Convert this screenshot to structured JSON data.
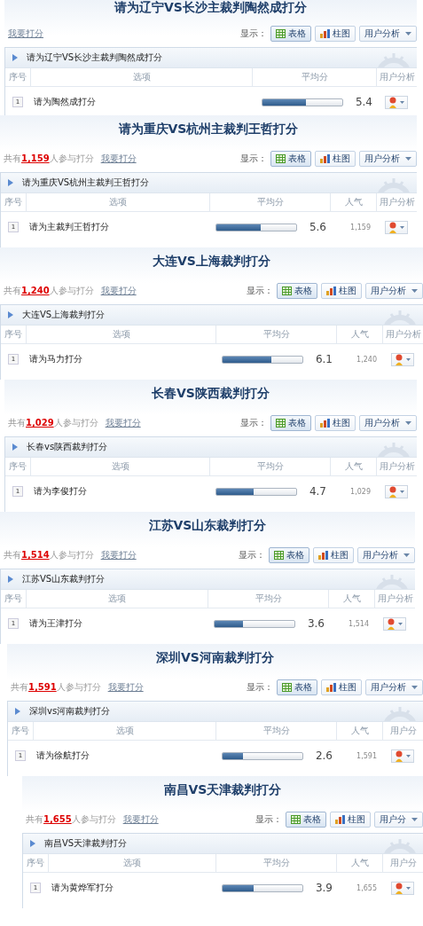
{
  "polls": [
    {
      "title": "请为辽宁VS长沙主裁判陶然成打分",
      "vote_link": "我要打分",
      "display_label": "显示：",
      "view_buttons": [
        {
          "label": "表格",
          "kind": "table",
          "selected": true
        },
        {
          "label": "柱图",
          "kind": "bar",
          "selected": false
        }
      ],
      "analysis_button": "用户分析",
      "subtitle": "请为辽宁VS长沙主裁判陶然成打分",
      "columns": [
        "序号",
        "选项",
        "平均分",
        "用户分析"
      ],
      "rows": [
        {
          "index": "1",
          "option": "请为陶然成打分",
          "level": 0.54,
          "score": "5.4"
        }
      ]
    },
    {
      "title": "请为重庆VS杭州主裁判王哲打分",
      "count": "共有**1,159**人参与打分",
      "vote_link": "我要打分",
      "display_label": "显示：",
      "view_buttons": [
        {
          "label": "表格",
          "kind": "table",
          "selected": true
        },
        {
          "label": "柱图",
          "kind": "bar",
          "selected": false
        }
      ],
      "analysis_button": "用户分析",
      "subtitle": "请为重庆VS杭州主裁判王哲打分",
      "columns": [
        "序号",
        "选项",
        "平均分",
        "人气",
        "用户分析"
      ],
      "rows": [
        {
          "index": "1",
          "option": "请为主裁判王哲打分",
          "level": 0.56,
          "score": "5.6",
          "popularity": "1,159"
        }
      ]
    },
    {
      "title": "大连VS上海裁判打分",
      "count": "共有**1,240**人参与打分",
      "vote_link": "我要打分",
      "display_label": "显示：",
      "view_buttons": [
        {
          "label": "表格",
          "kind": "table",
          "selected": true
        },
        {
          "label": "柱图",
          "kind": "bar",
          "selected": false
        }
      ],
      "analysis_button": "用户分析",
      "subtitle": "大连VS上海裁判打分",
      "columns": [
        "序号",
        "选项",
        "平均分",
        "人气",
        "用户分析"
      ],
      "rows": [
        {
          "index": "1",
          "option": "请为马力打分",
          "level": 0.61,
          "score": "6.1",
          "popularity": "1,240"
        }
      ]
    },
    {
      "title": "长春VS陕西裁判打分",
      "count": "共有**1,029**人参与打分",
      "vote_link": "我要打分",
      "display_label": "显示：",
      "view_buttons": [
        {
          "label": "表格",
          "kind": "table",
          "selected": true
        },
        {
          "label": "柱图",
          "kind": "bar",
          "selected": false
        }
      ],
      "analysis_button": "用户分析",
      "subtitle": "长春vs陕西裁判打分",
      "columns": [
        "序号",
        "选项",
        "平均分",
        "人气",
        "用户分析"
      ],
      "rows": [
        {
          "index": "1",
          "option": "请为李俊打分",
          "level": 0.47,
          "score": "4.7",
          "popularity": "1,029"
        }
      ]
    },
    {
      "title": "江苏VS山东裁判打分",
      "count": "共有**1,514**人参与打分",
      "vote_link": "我要打分",
      "display_label": "显示：",
      "view_buttons": [
        {
          "label": "表格",
          "kind": "table",
          "selected": true
        },
        {
          "label": "柱图",
          "kind": "bar",
          "selected": false
        }
      ],
      "analysis_button": "用户分析",
      "subtitle": "江苏VS山东裁判打分",
      "columns": [
        "序号",
        "选项",
        "平均分",
        "人气",
        "用户分析"
      ],
      "rows": [
        {
          "index": "1",
          "option": "请为王津打分",
          "level": 0.36,
          "score": "3.6",
          "popularity": "1,514"
        }
      ]
    },
    {
      "title": "深圳VS河南裁判打分",
      "count": "共有**1,591**人参与打分",
      "vote_link": "我要打分",
      "display_label": "显示：",
      "view_buttons": [
        {
          "label": "表格",
          "kind": "table",
          "selected": true
        },
        {
          "label": "柱图",
          "kind": "bar",
          "selected": false
        }
      ],
      "analysis_button": "用户分析",
      "subtitle": "深圳vs河南裁判打分",
      "columns": [
        "序号",
        "选项",
        "平均分",
        "人气",
        "用户分"
      ],
      "rows": [
        {
          "index": "1",
          "option": "请为徐航打分",
          "level": 0.26,
          "score": "2.6",
          "popularity": "1,591"
        }
      ]
    },
    {
      "title": "南昌VS天津裁判打分",
      "count": "共有**1,655**人参与打分",
      "vote_link": "我要打分",
      "display_label": "显示：",
      "view_buttons": [
        {
          "label": "表格",
          "kind": "table",
          "selected": true
        },
        {
          "label": "柱图",
          "kind": "bar",
          "selected": false
        }
      ],
      "analysis_button": "用户分",
      "subtitle": "南昌VS天津裁判打分",
      "columns": [
        "序号",
        "选项",
        "平均分",
        "人气",
        "用户分"
      ],
      "rows": [
        {
          "index": "1",
          "option": "请为黄烨军打分",
          "level": 0.39,
          "score": "3.9",
          "popularity": "1,655"
        }
      ]
    }
  ]
}
